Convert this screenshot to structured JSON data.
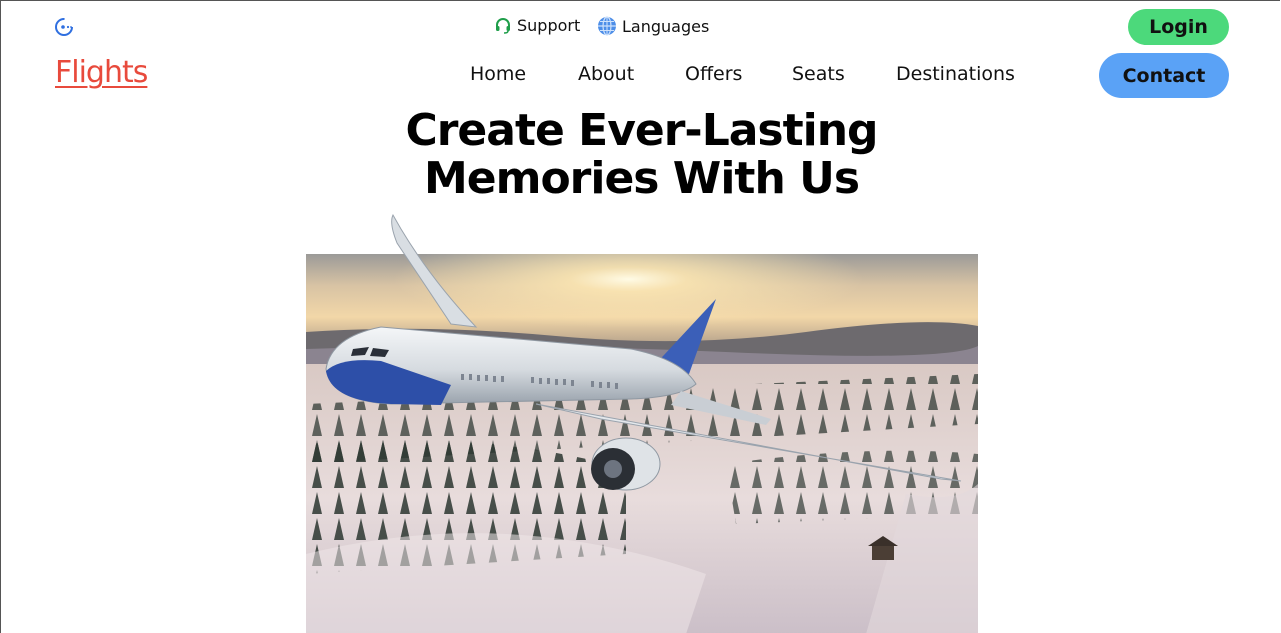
{
  "header": {
    "brand_icon": "loader-dots-icon",
    "support_label": "Support",
    "support_icon": "headset-icon",
    "languages_label": "Languages",
    "languages_icon": "globe-icon",
    "login_label": "Login",
    "login_color": "#4cd97b"
  },
  "nav": {
    "logo": "Flights",
    "logo_color": "#e84a3c",
    "items": [
      {
        "label": "Home"
      },
      {
        "label": "About"
      },
      {
        "label": "Offers"
      },
      {
        "label": "Seats"
      },
      {
        "label": "Destinations"
      }
    ],
    "contact_label": "Contact",
    "contact_color": "#5aa2f6"
  },
  "hero": {
    "title_line1": "Create Ever-Lasting",
    "title_line2": "Memories With Us",
    "image": "airplane-over-snowy-forest-at-sunset"
  }
}
